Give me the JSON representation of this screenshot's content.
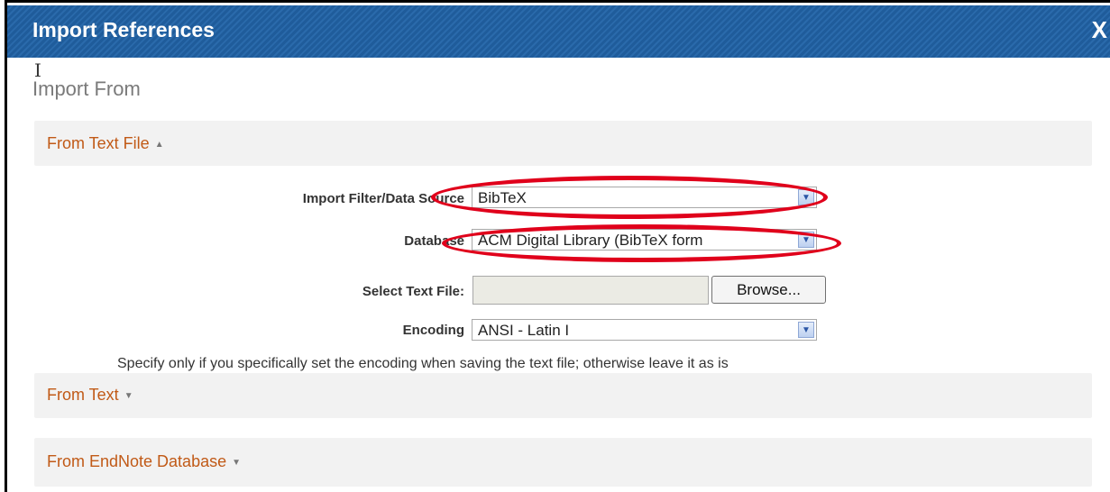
{
  "dialog": {
    "title": "Import References",
    "close_label": "X",
    "section_heading": "Import From"
  },
  "panels": {
    "text_file": {
      "title": "From Text File",
      "arrow": "▲"
    },
    "text": {
      "title": "From Text",
      "arrow": "▼"
    },
    "endnote": {
      "title": "From EndNote Database",
      "arrow": "▼"
    }
  },
  "form": {
    "filter_label": "Import Filter/Data Source",
    "filter_value": "BibTeX",
    "database_label": "Database",
    "database_value": "ACM Digital Library (BibTeX form",
    "file_label": "Select Text File:",
    "file_value": "",
    "browse_label": "Browse...",
    "encoding_label": "Encoding",
    "encoding_value": "ANSI - Latin I",
    "encoding_hint": "Specify only if you specifically set the encoding when saving the text file; otherwise leave it as is"
  },
  "colors": {
    "title_bar": "#1f5c9b",
    "panel_title": "#c15a17",
    "annotation_circle": "#e0001b"
  }
}
